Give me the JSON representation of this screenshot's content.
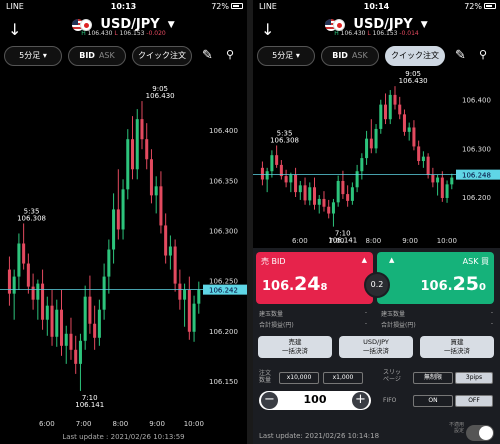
{
  "colors": {
    "up": "#2dc47c",
    "down": "#e34a5f",
    "price_line": "#5fd6e6",
    "bid": "#e6234b",
    "ask": "#15b27a"
  },
  "left": {
    "status": {
      "carrier": "LINE",
      "time": "10:13",
      "battery": "72%"
    },
    "header": {
      "pair": "USD/JPY",
      "high_label": "H",
      "high": "106.430",
      "low_label": "L",
      "low": "106.153",
      "change": "-0.020"
    },
    "toolbar": {
      "timeframe": "5分足",
      "bid": "BID",
      "ask": "ASK",
      "quick_order": "クイック注文"
    },
    "chart_data": {
      "type": "candlestick",
      "ylim": [
        106.12,
        106.455
      ],
      "yticks": [
        "106.400",
        "106.350",
        "106.300",
        "106.250",
        "106.200",
        "106.150"
      ],
      "xticks": [
        "6:00",
        "7:00",
        "8:00",
        "9:00",
        "10:00"
      ],
      "current_price": "106.242",
      "annotations": [
        {
          "time": "9:05",
          "price": "106.430"
        },
        {
          "time": "5:35",
          "price": "106.308"
        },
        {
          "time": "7:10",
          "price": "106.141"
        }
      ],
      "candles": [
        [
          106.262,
          106.275,
          106.226,
          106.238
        ],
        [
          106.238,
          106.262,
          106.212,
          106.255
        ],
        [
          106.255,
          106.298,
          106.242,
          106.288
        ],
        [
          106.288,
          106.308,
          106.262,
          106.268
        ],
        [
          106.268,
          106.278,
          106.238,
          106.245
        ],
        [
          106.245,
          106.258,
          106.222,
          106.232
        ],
        [
          106.232,
          106.252,
          106.212,
          106.248
        ],
        [
          106.248,
          106.262,
          106.202,
          106.212
        ],
        [
          106.212,
          106.235,
          106.196,
          106.226
        ],
        [
          106.226,
          106.242,
          106.186,
          106.195
        ],
        [
          106.195,
          106.232,
          106.185,
          106.222
        ],
        [
          106.222,
          106.242,
          106.176,
          106.186
        ],
        [
          106.186,
          106.206,
          106.168,
          106.198
        ],
        [
          106.198,
          106.214,
          106.172,
          106.182
        ],
        [
          106.182,
          106.196,
          106.158,
          106.168
        ],
        [
          106.168,
          106.198,
          106.141,
          106.191
        ],
        [
          106.191,
          106.246,
          106.182,
          106.235
        ],
        [
          106.235,
          106.256,
          106.198,
          106.208
        ],
        [
          106.208,
          106.226,
          106.182,
          106.194
        ],
        [
          106.194,
          106.232,
          106.186,
          106.222
        ],
        [
          106.222,
          106.268,
          106.212,
          106.255
        ],
        [
          106.255,
          106.292,
          106.238,
          106.282
        ],
        [
          106.282,
          106.338,
          106.268,
          106.322
        ],
        [
          106.322,
          106.362,
          106.292,
          106.302
        ],
        [
          106.302,
          106.352,
          106.292,
          106.342
        ],
        [
          106.342,
          106.402,
          106.332,
          106.392
        ],
        [
          106.392,
          106.415,
          106.352,
          106.362
        ],
        [
          106.362,
          106.422,
          106.352,
          106.412
        ],
        [
          106.412,
          106.43,
          106.382,
          106.392
        ],
        [
          106.392,
          106.408,
          106.362,
          106.372
        ],
        [
          106.372,
          106.382,
          106.328,
          106.336
        ],
        [
          106.336,
          106.355,
          106.318,
          106.345
        ],
        [
          106.345,
          106.36,
          106.298,
          106.306
        ],
        [
          106.306,
          106.318,
          106.268,
          106.276
        ],
        [
          106.276,
          106.296,
          106.262,
          106.285
        ],
        [
          106.285,
          106.292,
          106.24,
          106.248
        ],
        [
          106.248,
          106.262,
          106.222,
          106.232
        ],
        [
          106.232,
          106.248,
          106.205,
          106.242
        ],
        [
          106.242,
          106.255,
          106.192,
          106.2
        ],
        [
          106.2,
          106.236,
          106.19,
          106.228
        ],
        [
          106.228,
          106.25,
          106.218,
          106.242
        ]
      ]
    },
    "footer": "Last update : 2021/02/26 10:13:59"
  },
  "right": {
    "status": {
      "carrier": "LINE",
      "time": "10:14",
      "battery": "72%"
    },
    "header": {
      "pair": "USD/JPY",
      "high_label": "H",
      "high": "106.430",
      "low_label": "L",
      "low": "106.153",
      "change": "-0.014"
    },
    "toolbar": {
      "timeframe": "5分足",
      "bid": "BID",
      "ask": "ASK",
      "quick_order": "クイック注文"
    },
    "chart_data": {
      "type": "candlestick",
      "ylim": [
        106.13,
        106.455
      ],
      "yticks": [
        "106.400",
        "106.300",
        "106.200"
      ],
      "xticks": [
        "6:00",
        "7:00",
        "8:00",
        "9:00",
        "10:00"
      ],
      "current_price": "106.248",
      "annotations": [
        {
          "time": "9:05",
          "price": "106.430"
        },
        {
          "time": "5:35",
          "price": "106.308"
        },
        {
          "time": "7:10",
          "price": "106.141"
        }
      ]
    },
    "trade": {
      "bid_label": "BID",
      "bid_char": "売",
      "bid_price_big": "106.",
      "bid_price_pips": "24",
      "bid_price_tail": "8",
      "ask_label": "ASK",
      "ask_char": "買",
      "ask_price_big": "106.",
      "ask_price_pips": "25",
      "ask_price_tail": "0",
      "spread": "0.2",
      "bid_position_label": "建玉数量",
      "bid_position_value": "-",
      "bid_pl_label": "合計損益(円)",
      "bid_pl_value": "-",
      "ask_position_label": "建玉数量",
      "ask_position_value": "-",
      "ask_pl_label": "合計損益(円)",
      "ask_pl_value": "-",
      "close_sell": [
        "売建",
        "一括決済"
      ],
      "close_pair": [
        "USD/JPY",
        "一括決済"
      ],
      "close_buy": [
        "買建",
        "一括決済"
      ],
      "qty_label": [
        "注文",
        "数量"
      ],
      "qty_preset_1": "x10,000",
      "qty_preset_2": "x1,000",
      "slippage_label": [
        "スリッ",
        "ページ"
      ],
      "slippage_unlimited": "無制限",
      "slippage_pips": "3pips",
      "quantity": "100",
      "fifo_label": "FIFO",
      "fifo_on": "ON",
      "fifo_off": "OFF",
      "footer": "Last update: 2021/02/26 10:14:18",
      "toggle_label": [
        "不適用",
        "設定"
      ]
    }
  }
}
